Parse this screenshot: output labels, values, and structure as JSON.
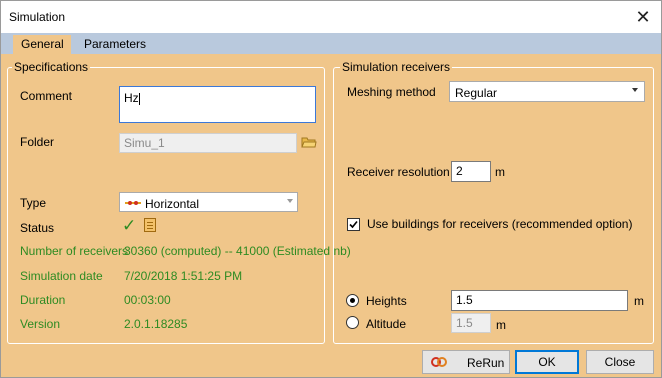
{
  "window": {
    "title": "Simulation"
  },
  "tabs": [
    {
      "label": "General"
    },
    {
      "label": "Parameters"
    }
  ],
  "specifications": {
    "group_title": "Specifications",
    "comment_label": "Comment",
    "comment_value": "Hz",
    "folder_label": "Folder",
    "folder_value": "Simu_1",
    "type_label": "Type",
    "type_value": "Horizontal",
    "status_label": "Status",
    "receivers_label": "Number of receivers",
    "receivers_value": "30360 (computed) -- 41000 (Estimated nb)",
    "date_label": "Simulation date",
    "date_value": "7/20/2018 1:51:25 PM",
    "duration_label": "Duration",
    "duration_value": "00:03:00",
    "version_label": "Version",
    "version_value": "2.0.1.18285"
  },
  "receivers": {
    "group_title": "Simulation receivers",
    "meshing_label": "Meshing method",
    "meshing_value": "Regular",
    "resolution_label": "Receiver resolution",
    "resolution_value": "2",
    "resolution_unit": "m",
    "buildings_label": "Use buildings for receivers (recommended option)",
    "buildings_checked": true,
    "heights_label": "Heights",
    "heights_value": "1.5",
    "heights_unit": "m",
    "altitude_label": "Altitude",
    "altitude_value": "1.5",
    "altitude_unit": "m"
  },
  "buttons": {
    "rerun": "ReRun",
    "ok": "OK",
    "close": "Close"
  },
  "colors": {
    "background": "#f0c68a",
    "tabstrip": "#b9c9dd",
    "value_green": "#2e8b22"
  }
}
